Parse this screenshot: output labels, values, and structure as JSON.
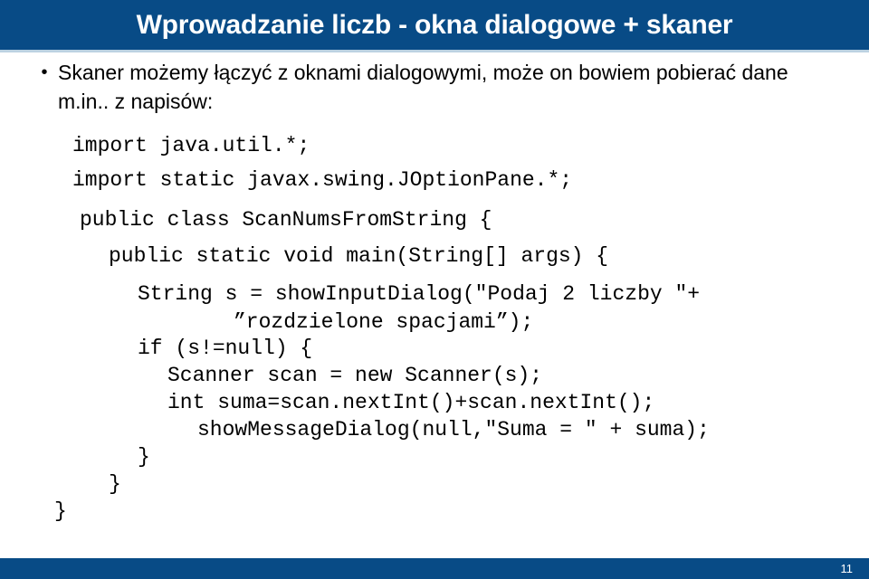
{
  "slide": {
    "title": "Wprowadzanie liczb - okna dialogowe + skaner",
    "page_number": "11",
    "colors": {
      "header_blue": "#084b86",
      "header_underline": "#bcd2e2",
      "footer_blue": "#084b86",
      "body_background": "#ffffff",
      "text": "#000000",
      "title_text": "#ffffff"
    }
  },
  "bullets": [
    {
      "marker": "•",
      "text": "Skaner możemy łączyć z oknami dialogowymi, może on bowiem pobierać dane m.in.. z napisów:"
    }
  ],
  "code": {
    "language": "java",
    "lines": [
      "import java.util.*;",
      "import static javax.swing.JOptionPane.*;",
      "public class ScanNumsFromString {",
      "public static void main(String[] args) {",
      "String s = showInputDialog(\"Podaj 2 liczby \"+",
      "”rozdzielone spacjami”);",
      "if (s!=null) {",
      "Scanner scan = new Scanner(s);",
      "int suma=scan.nextInt()+scan.nextInt();",
      "showMessageDialog(null,\"Suma = \" + suma);",
      "}",
      "}",
      "}"
    ]
  }
}
